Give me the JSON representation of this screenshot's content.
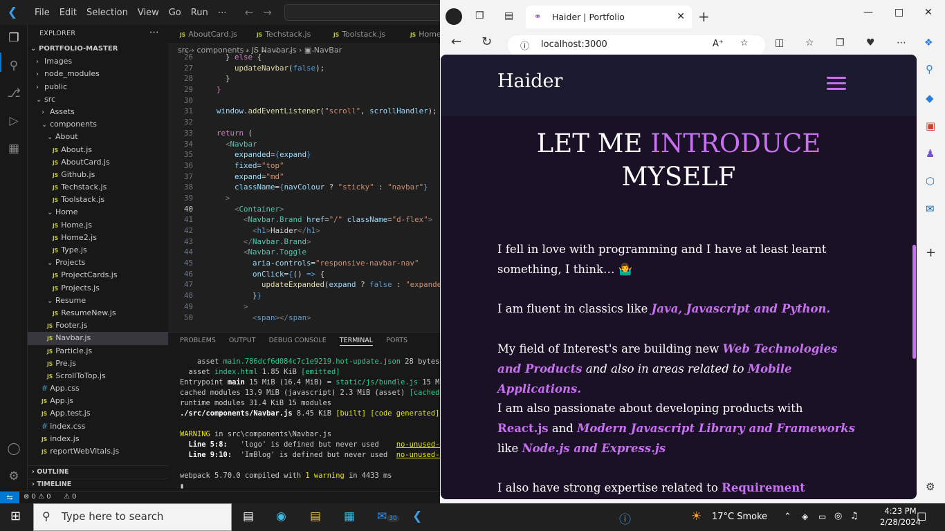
{
  "vscode": {
    "menu": [
      "File",
      "Edit",
      "Selection",
      "View",
      "Go",
      "Run",
      "⋯"
    ],
    "explorer_title": "EXPLORER",
    "root": "PORTFOLIO-MASTER",
    "tree": [
      {
        "label": "Images",
        "kind": "folder",
        "depth": 1
      },
      {
        "label": "node_modules",
        "kind": "folder",
        "depth": 1
      },
      {
        "label": "public",
        "kind": "folder",
        "depth": 1
      },
      {
        "label": "src",
        "kind": "folder-open",
        "depth": 1
      },
      {
        "label": "Assets",
        "kind": "folder",
        "depth": 2
      },
      {
        "label": "components",
        "kind": "folder-open",
        "depth": 2
      },
      {
        "label": "About",
        "kind": "folder-open",
        "depth": 3
      },
      {
        "label": "About.js",
        "kind": "js",
        "depth": 4
      },
      {
        "label": "AboutCard.js",
        "kind": "js",
        "depth": 4
      },
      {
        "label": "Github.js",
        "kind": "js",
        "depth": 4
      },
      {
        "label": "Techstack.js",
        "kind": "js",
        "depth": 4
      },
      {
        "label": "Toolstack.js",
        "kind": "js",
        "depth": 4
      },
      {
        "label": "Home",
        "kind": "folder-open",
        "depth": 3
      },
      {
        "label": "Home.js",
        "kind": "js",
        "depth": 4
      },
      {
        "label": "Home2.js",
        "kind": "js",
        "depth": 4
      },
      {
        "label": "Type.js",
        "kind": "js",
        "depth": 4
      },
      {
        "label": "Projects",
        "kind": "folder-open",
        "depth": 3
      },
      {
        "label": "ProjectCards.js",
        "kind": "js",
        "depth": 4
      },
      {
        "label": "Projects.js",
        "kind": "js",
        "depth": 4
      },
      {
        "label": "Resume",
        "kind": "folder-open",
        "depth": 3
      },
      {
        "label": "ResumeNew.js",
        "kind": "js",
        "depth": 4
      },
      {
        "label": "Footer.js",
        "kind": "js",
        "depth": 3
      },
      {
        "label": "Navbar.js",
        "kind": "js",
        "depth": 3,
        "selected": true
      },
      {
        "label": "Particle.js",
        "kind": "js",
        "depth": 3
      },
      {
        "label": "Pre.js",
        "kind": "js",
        "depth": 3
      },
      {
        "label": "ScrollToTop.js",
        "kind": "js",
        "depth": 3
      },
      {
        "label": "App.css",
        "kind": "css",
        "depth": 2
      },
      {
        "label": "App.js",
        "kind": "js",
        "depth": 2
      },
      {
        "label": "App.test.js",
        "kind": "js",
        "depth": 2
      },
      {
        "label": "index.css",
        "kind": "css",
        "depth": 2
      },
      {
        "label": "index.js",
        "kind": "js",
        "depth": 2
      },
      {
        "label": "reportWebVitals.js",
        "kind": "js",
        "depth": 2
      }
    ],
    "outline": "OUTLINE",
    "timeline": "TIMELINE",
    "tabs": [
      "AboutCard.js",
      "Techstack.js",
      "Toolstack.js",
      "Home.js"
    ],
    "breadcrumb": "src › components › JS Navbar.js › ▣ NavBar",
    "panel_tabs": [
      "PROBLEMS",
      "OUTPUT",
      "DEBUG CONSOLE",
      "TERMINAL",
      "PORTS"
    ],
    "status_left": "⊗ 0 ⚠ 0",
    "status_ports": "⚠ 0"
  },
  "browser": {
    "tab_title": "Haider | Portfolio",
    "url": "localhost:3000",
    "brand": "Haider",
    "hero_a": "LET ME ",
    "hero_b": "INTRODUCE",
    "hero_c": "MYSELF",
    "p1": "I fell in love with programming and I have at least learnt something, I think… 🤷‍♂️",
    "p2a": "I am fluent in classics like ",
    "p2b": "Java, Javascript and Python.",
    "p3a": "My field of Interest's are building new ",
    "p3b": "Web Technologies and Products",
    "p3c": " and also in areas related to ",
    "p3d": "Mobile Applications.",
    "p4a": "I am also passionate about developing products with ",
    "p4b": "React.js",
    "p4c": " and ",
    "p4d": "Modern Javascript Library and Frameworks",
    "p4e": " like ",
    "p4f": "Node.js and Express.js",
    "p5a": "I also have strong expertise related to ",
    "p5b": "Requirement Engineering",
    "accent": "#c770f0"
  },
  "taskbar": {
    "search_placeholder": "Type here to search",
    "weather": "17°C  Smoke",
    "time": "4:23 PM",
    "date": "2/28/2024",
    "mail_badge": "30"
  }
}
